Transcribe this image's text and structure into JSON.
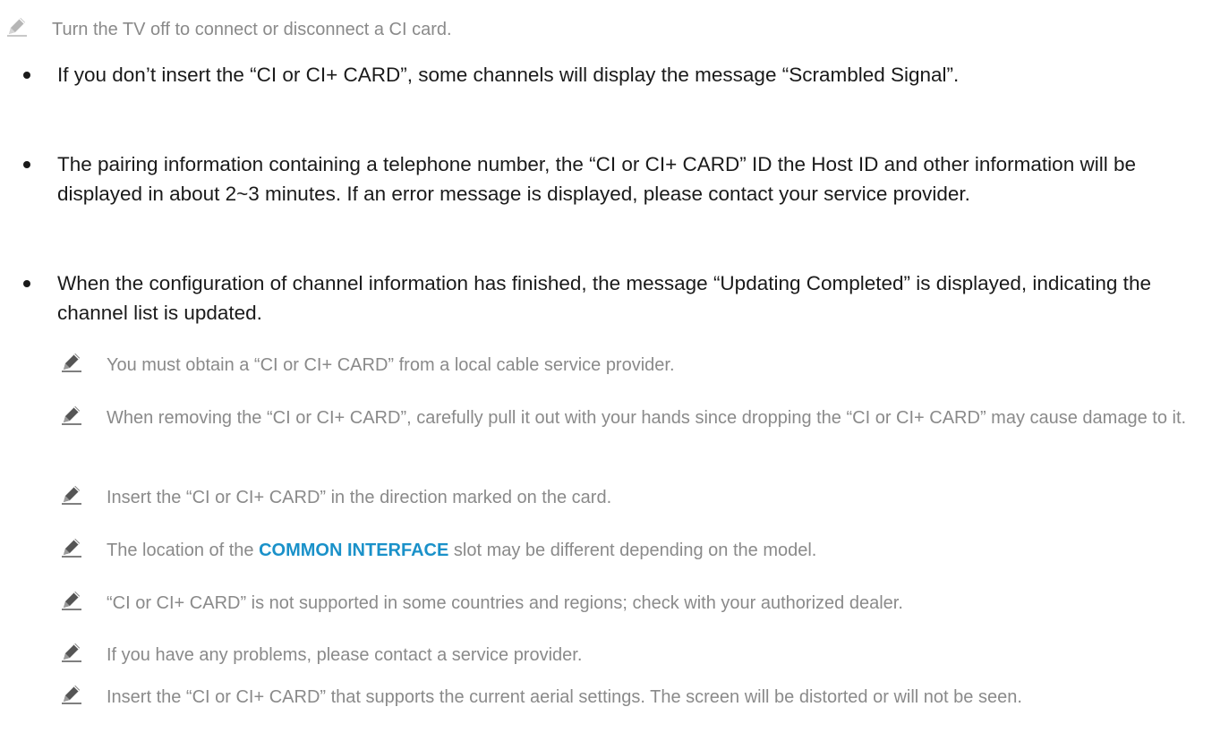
{
  "top_note": {
    "icon": "pencil-icon",
    "text": "Turn the TV off to connect or disconnect a CI card."
  },
  "bullets": [
    "If you don’t insert the “CI or CI+ CARD”, some channels will display the message “Scrambled Signal”.",
    "The pairing information containing a telephone number, the “CI or CI+ CARD” ID the Host ID and other information will be displayed in about 2~3 minutes. If an error message is displayed, please contact your service provider.",
    "When the configuration of channel information has finished, the message “Updating Completed” is displayed, indicating the channel list is updated."
  ],
  "sub_notes": [
    {
      "icon": "pencil-icon",
      "text": "You must obtain a “CI or CI+ CARD” from a local cable service provider."
    },
    {
      "icon": "pencil-icon",
      "text": "When removing the “CI or CI+ CARD”, carefully pull it out with your hands since dropping the “CI or CI+ CARD” may cause damage to it."
    },
    {
      "icon": "pencil-icon",
      "text": "Insert the “CI or CI+ CARD” in the direction marked on the card."
    },
    {
      "icon": "pencil-icon",
      "text_before": "The location of the ",
      "highlight": "COMMON INTERFACE",
      "text_after": " slot may be different depending on the model.",
      "highlight_color": "#1a91c9"
    },
    {
      "icon": "pencil-icon",
      "text": "“CI or CI+ CARD” is not supported in some countries and regions; check with your authorized dealer."
    },
    {
      "icon": "pencil-icon",
      "text": "If you have any problems, please contact a service provider."
    },
    {
      "icon": "pencil-icon",
      "text": "Insert the “CI or CI+ CARD” that supports the current aerial settings. The screen will be distorted or will not be seen."
    }
  ]
}
